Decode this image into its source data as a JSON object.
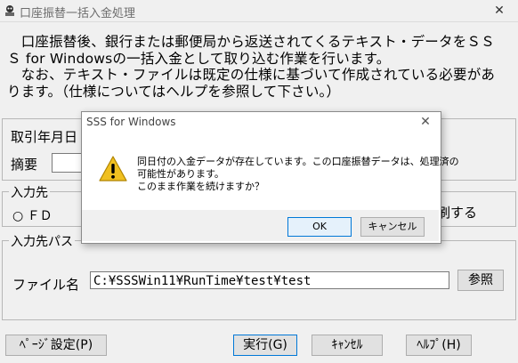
{
  "window": {
    "title": "口座振替一括入金処理",
    "close_glyph": "✕"
  },
  "intro": {
    "line1": "　口座振替後、銀行または郵便局から返送されてくるテキスト・データをＳＳ",
    "line2": "Ｓ for Windowsの一括入金として取り込む作業を行います。",
    "line3": "　なお、テキスト・ファイルは既定の仕様に基づいて作成されている必要があ",
    "line4": "ります。（仕様についてはヘルプを参照して下さい。）"
  },
  "form": {
    "date_label": "取引年月日",
    "summary_label": "摘要",
    "summary_value": "",
    "dest_group_label": "入力先",
    "radio_fd_label": "ＦＤ",
    "print_label": "刷する",
    "path_group_label": "入力先パス",
    "file_label": "ファイル名",
    "file_value": "C:¥SSSWin11¥RunTime¥test¥test",
    "browse_label": "参照"
  },
  "buttons": {
    "page_setup": "ﾍﾟｰｼﾞ設定(P)",
    "run": "実行(G)",
    "cancel": "ｷｬﾝｾﾙ",
    "help": "ﾍﾙﾌﾟ(H)"
  },
  "dialog": {
    "title": "SSS for Windows",
    "close_glyph": "✕",
    "icon": "warning-icon",
    "message_line1": "同日付の入金データが存在しています。この口座振替データは、処理済の",
    "message_line2": "可能性があります。",
    "message_line3": "このまま作業を続けますか？",
    "ok_label": "OK",
    "cancel_label": "キャンセル"
  },
  "colors": {
    "window_bg": "#f0f0f0",
    "dialog_bg": "#ffffff",
    "accent": "#0078d7",
    "warning": "#f0c020"
  }
}
